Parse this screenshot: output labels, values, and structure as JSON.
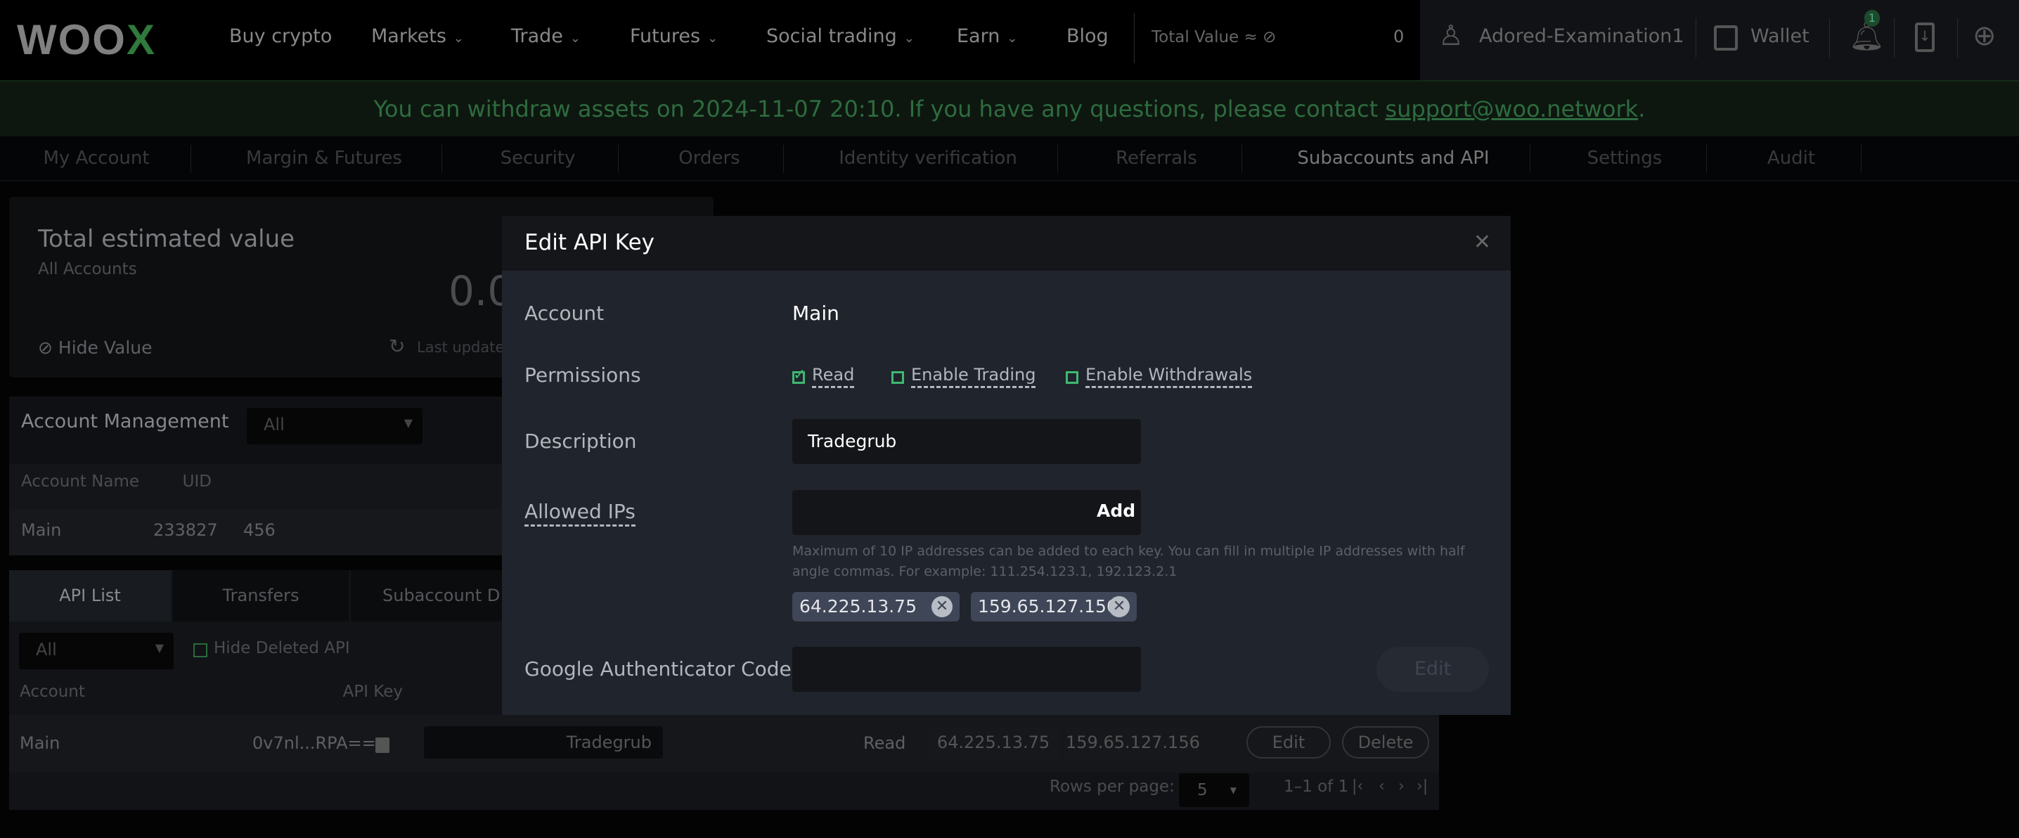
{
  "header": {
    "logo": {
      "main": "WOO",
      "accent": "X"
    },
    "nav": [
      {
        "label": "Buy crypto",
        "dropdown": false
      },
      {
        "label": "Markets",
        "dropdown": true
      },
      {
        "label": "Trade",
        "dropdown": true
      },
      {
        "label": "Futures",
        "dropdown": true
      },
      {
        "label": "Social trading",
        "dropdown": true
      },
      {
        "label": "Earn",
        "dropdown": true
      },
      {
        "label": "Blog",
        "dropdown": false
      }
    ],
    "total_value_label": "Total Value ≈",
    "total_value": "0",
    "username": "Adored-Examination1",
    "wallet": "Wallet",
    "notification_count": "1"
  },
  "banner": {
    "text": "You can withdraw assets on 2024-11-07 20:10. If you have any questions, please contact ",
    "email": "support@woo.network",
    "end": "."
  },
  "subnav": [
    "My Account",
    "Margin & Futures",
    "Security",
    "Orders",
    "Identity verification",
    "Referrals",
    "Subaccounts and API",
    "Settings",
    "Audit"
  ],
  "summary": {
    "title": "Total estimated value",
    "subtitle": "All Accounts",
    "value": "0.0",
    "hide_value": "Hide Value",
    "last_updated": "Last updated"
  },
  "account_mgmt": {
    "title": "Account Management",
    "filter": "All",
    "columns": [
      "Account Name",
      "UID"
    ],
    "row": {
      "name": "Main",
      "uid": "233827",
      "partial": "456"
    }
  },
  "api": {
    "tabs": [
      "API List",
      "Transfers",
      "Subaccount D"
    ],
    "filter": "All",
    "hide_deleted": "Hide Deleted API",
    "columns": [
      "Account",
      "API Key"
    ],
    "row": {
      "account": "Main",
      "key": "0v7nl...RPA==",
      "description": "Tradegrub",
      "permission": "Read",
      "ips": [
        "64.225.13.75",
        "159.65.127.156"
      ],
      "edit": "Edit",
      "delete": "Delete"
    },
    "rows_per_page_label": "Rows per page:",
    "rows_per_page": "5",
    "range": "1–1 of 1"
  },
  "modal": {
    "title": "Edit API Key",
    "account_label": "Account",
    "account": "Main",
    "permissions_label": "Permissions",
    "permissions": [
      {
        "label": "Read",
        "checked": true
      },
      {
        "label": "Enable Trading",
        "checked": false
      },
      {
        "label": "Enable Withdrawals",
        "checked": false
      }
    ],
    "description_label": "Description",
    "description": "Tradegrub",
    "ips_label": "Allowed IPs",
    "add": "Add",
    "hint": "Maximum of 10 IP addresses can be added to each key. You can fill in multiple IP addresses with half angle commas. For example: 111.254.123.1, 192.123.2.1",
    "ips": [
      "64.225.13.75",
      "159.65.127.156"
    ],
    "ga_label": "Google Authenticator Code",
    "ga_value": "",
    "submit": "Edit"
  },
  "colors": {
    "accent": "#2f7a3c",
    "checkbox": "#3fb871",
    "modal_bg": "#20242c"
  }
}
